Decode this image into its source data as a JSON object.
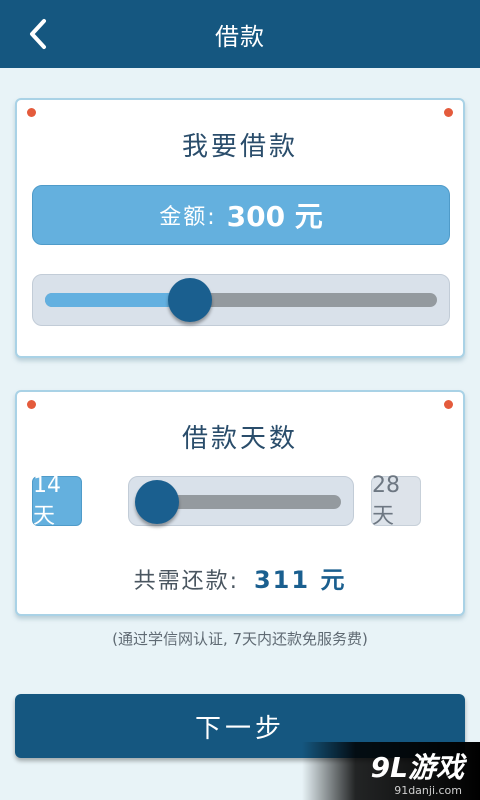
{
  "header": {
    "title": "借款"
  },
  "amount_card": {
    "title": "我要借款",
    "amount_label": "金额:",
    "amount_value": "300 元",
    "slider_position": 0.37
  },
  "days_card": {
    "title": "借款天数",
    "min_label": "14天",
    "max_label": "28天",
    "slider_position": 0.0,
    "total_label": "共需还款:",
    "total_value": "311 元"
  },
  "note": "(通过学信网认证, 7天内还款免服务费)",
  "next_button": "下一步",
  "watermark": {
    "logo": "9L游戏",
    "url": "91danji.com"
  },
  "colors": {
    "primary": "#155780",
    "accent": "#64b0de",
    "background": "#e8f3f7",
    "dot": "#e45b3c"
  }
}
